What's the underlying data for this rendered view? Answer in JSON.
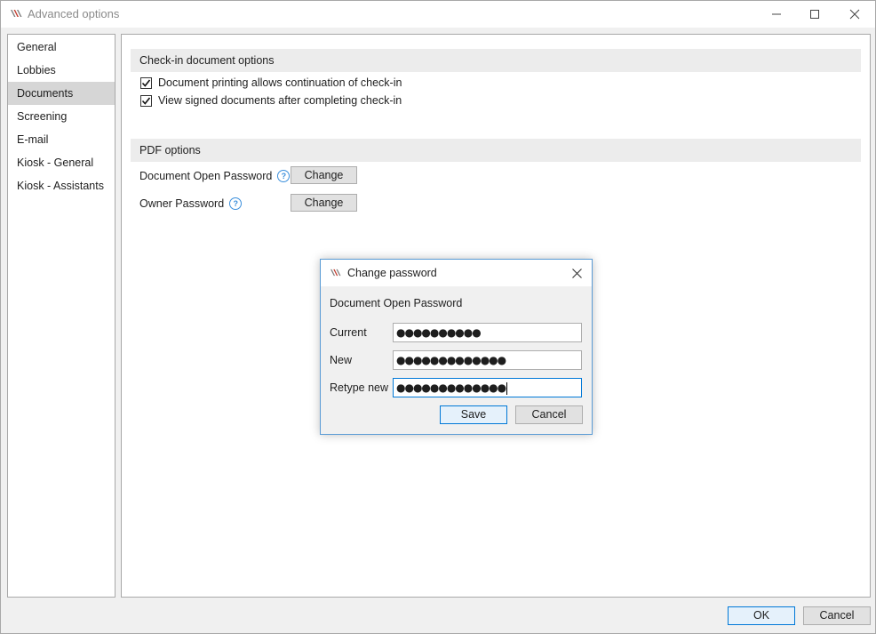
{
  "window": {
    "title": "Advanced options",
    "app_icon": "app-logo-icon",
    "controls": [
      "minimize-icon",
      "maximize-icon",
      "close-icon"
    ]
  },
  "sidebar": {
    "items": [
      {
        "label": "General",
        "selected": false
      },
      {
        "label": "Lobbies",
        "selected": false
      },
      {
        "label": "Documents",
        "selected": true
      },
      {
        "label": "Screening",
        "selected": false
      },
      {
        "label": "E-mail",
        "selected": false
      },
      {
        "label": "Kiosk - General",
        "selected": false
      },
      {
        "label": "Kiosk - Assistants",
        "selected": false
      }
    ]
  },
  "checkin": {
    "header": "Check-in document options",
    "options": [
      {
        "label": "Document printing allows continuation of check-in",
        "checked": true
      },
      {
        "label": "View signed documents after completing check-in",
        "checked": true
      }
    ]
  },
  "pdf": {
    "header": "PDF options",
    "rows": [
      {
        "label": "Document Open Password",
        "button": "Change"
      },
      {
        "label": "Owner Password",
        "button": "Change"
      }
    ]
  },
  "dialog": {
    "title": "Change password",
    "subtitle": "Document Open Password",
    "fields": [
      {
        "label": "Current",
        "value": "●●●●●●●●●●",
        "focused": false
      },
      {
        "label": "New",
        "value": "●●●●●●●●●●●●●",
        "focused": false
      },
      {
        "label": "Retype new",
        "value": "●●●●●●●●●●●●●",
        "focused": true
      }
    ],
    "save_label": "Save",
    "cancel_label": "Cancel"
  },
  "footer": {
    "ok_label": "OK",
    "cancel_label": "Cancel"
  },
  "colors": {
    "accent": "#0078d7",
    "help": "#3b8fdc",
    "selected_nav": "#d6d6d6"
  }
}
